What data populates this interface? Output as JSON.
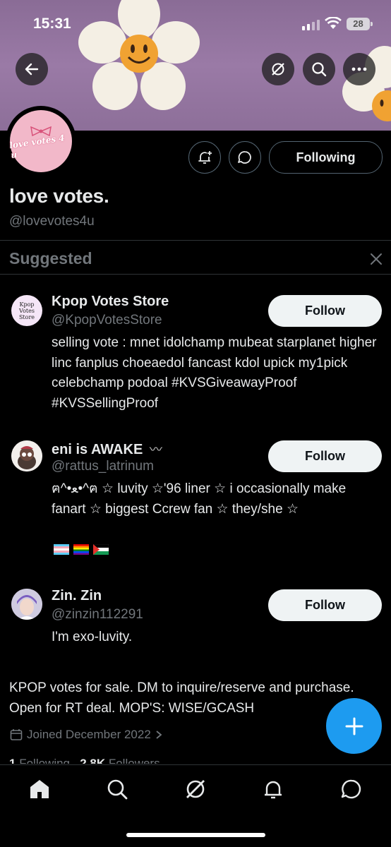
{
  "status_bar": {
    "time": "15:31",
    "battery": "28"
  },
  "header_actions": {
    "back": "back-arrow-icon",
    "grok": "grok-icon",
    "search": "search-icon",
    "more": "more-icon"
  },
  "profile": {
    "avatar_text": "love votes 4 u",
    "display_name": "love votes.",
    "handle": "@lovevotes4u",
    "following_label": "Following",
    "bio": "KPOP votes for sale. DM to inquire/reserve and purchase. Open for RT deal. MOP'S: WISE/GCASH",
    "joined": "Joined December 2022",
    "following_count": "1",
    "following_label_text": "Following",
    "followers_count": "2.8K",
    "followers_label_text": "Followers"
  },
  "suggested": {
    "title": "Suggested",
    "items": [
      {
        "name": "Kpop Votes Store",
        "handle": "@KpopVotesStore",
        "avatar_text": "Kpop Votes Store",
        "follow_label": "Follow",
        "bio": "selling vote : mnet idolchamp mubeat starplanet higher linc fanplus choeaedol fancast kdol upick my1pick celebchamp podoal #KVSGiveawayProof #KVSSellingProof"
      },
      {
        "name": "eni is AWAKE",
        "name_emoji": "〰",
        "handle": "@rattus_latrinum",
        "follow_label": "Follow",
        "bio": "ฅ^•ﻌ•^ฅ ☆ luvity ☆'96 liner ☆ i occasionally make fanart ☆ biggest Ccrew fan ☆ they/she ☆",
        "flags": [
          "trans-flag",
          "rainbow-flag",
          "palestine-flag"
        ]
      },
      {
        "name": "Zin. Zin",
        "handle": "@zinzin112291",
        "follow_label": "Follow",
        "bio": "I'm exo-luvity."
      }
    ]
  },
  "tabs": [
    "home-icon",
    "search-icon",
    "grok-icon",
    "notifications-icon",
    "messages-icon"
  ],
  "colors": {
    "accent": "#1d9bf0",
    "muted": "#71767b",
    "border": "#2f3336",
    "banner": "#8a6c96"
  }
}
